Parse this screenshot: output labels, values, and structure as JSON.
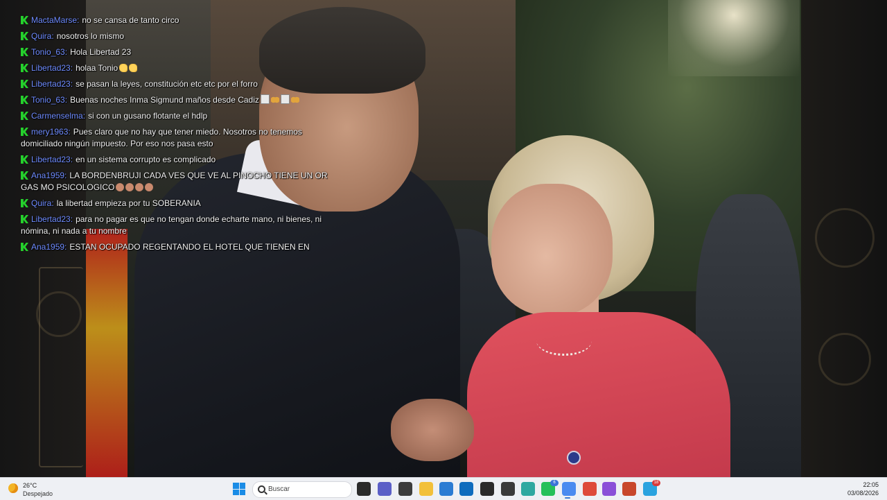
{
  "chat": {
    "messages": [
      {
        "user": "MactaMarse",
        "text": "no se cansa de tanto circo",
        "emojis": []
      },
      {
        "user": "Quira",
        "text": "nosotros lo mismo",
        "emojis": []
      },
      {
        "user": "Tonio_63",
        "text": "Hola Libertad 23",
        "emojis": []
      },
      {
        "user": "Libertad23",
        "text": "holaa Tonio",
        "emojis": [
          "waving-hand-emoji",
          "waving-hand-emoji"
        ]
      },
      {
        "user": "Libertad23",
        "text": "se pasan la leyes, constitución etc etc por el forro",
        "emojis": []
      },
      {
        "user": "Tonio_63",
        "text": "Buenas noches Inma Sigmund maños desde Cadiz",
        "emojis": [
          "card-emoji",
          "butterfly-emoji",
          "card-emoji",
          "butterfly-emoji"
        ]
      },
      {
        "user": "Carmenselma",
        "text": "si con un gusano flotante el hdlp",
        "emojis": []
      },
      {
        "user": "mery1963",
        "text": "Pues claro que no hay que tener miedo. Nosotros no tenemos domiciliado ningún impuesto. Por eso nos pasa esto",
        "emojis": []
      },
      {
        "user": "Libertad23",
        "text": "en un sistema corrupto es complicado",
        "emojis": []
      },
      {
        "user": "Ana1959",
        "text": "LA BORDENBRUJI CADA VES QUE VE AL PINOCHO TIENE UN OR GAS MO PSICOLOGICO",
        "emojis": [
          "face-emoji",
          "face-emoji",
          "face-emoji",
          "face-emoji"
        ]
      },
      {
        "user": "Quira",
        "text": "la libertad empieza por tu SOBERANIA",
        "emojis": []
      },
      {
        "user": "Libertad23",
        "text": "para no pagar es que no tengan donde echarte mano, ni bienes, ni nómina, ni nada a tu nombre",
        "emojis": []
      },
      {
        "user": "Ana1959",
        "text": "ESTAN OCUPADO REGENTANDO EL HOTEL QUE TIENEN EN",
        "emojis": []
      }
    ]
  },
  "taskbar": {
    "weather": {
      "temp": "26°C",
      "condition": "Despejado",
      "icon": "moon-icon"
    },
    "search_placeholder": "Buscar",
    "apps": [
      {
        "name": "start-button",
        "icon": "windows-icon"
      },
      {
        "name": "task-view-button",
        "icon": "task-view-icon",
        "color": "#2a2a2a"
      },
      {
        "name": "teams-app",
        "icon": "teams-icon",
        "color": "#5b5fc7"
      },
      {
        "name": "app-3",
        "icon": "photos-icon",
        "color": "#3c3c3c"
      },
      {
        "name": "file-explorer-app",
        "icon": "folder-icon",
        "color": "#f2c03a"
      },
      {
        "name": "store-app",
        "icon": "store-icon",
        "color": "#2b7cd3"
      },
      {
        "name": "outlook-app",
        "icon": "outlook-icon",
        "color": "#0f6cbd"
      },
      {
        "name": "app-7",
        "icon": "app-icon",
        "color": "#2a2a2a"
      },
      {
        "name": "app-8",
        "icon": "cube-icon",
        "color": "#3a3a3a"
      },
      {
        "name": "edge-app",
        "icon": "edge-icon",
        "color": "#2ea8a0"
      },
      {
        "name": "whatsapp-app",
        "icon": "whatsapp-icon",
        "color": "#25c05a",
        "badge": "6"
      },
      {
        "name": "chrome-app-active",
        "icon": "chrome-icon",
        "color": "#4a8bf0"
      },
      {
        "name": "chrome-app",
        "icon": "chrome-icon",
        "color": "#de4a3a"
      },
      {
        "name": "app-13",
        "icon": "circle-app-icon",
        "color": "#8a4fd8"
      },
      {
        "name": "powerpoint-app",
        "icon": "powerpoint-icon",
        "color": "#c8472b"
      },
      {
        "name": "telegram-app",
        "icon": "telegram-icon",
        "color": "#2aa3df",
        "badge": "18"
      }
    ],
    "clock": {
      "time": "22:05",
      "date": "03/08/2026"
    }
  },
  "colors": {
    "username": "#6f8cff",
    "badge": "#25d12c",
    "taskbar_bg": "#eef0f4"
  }
}
